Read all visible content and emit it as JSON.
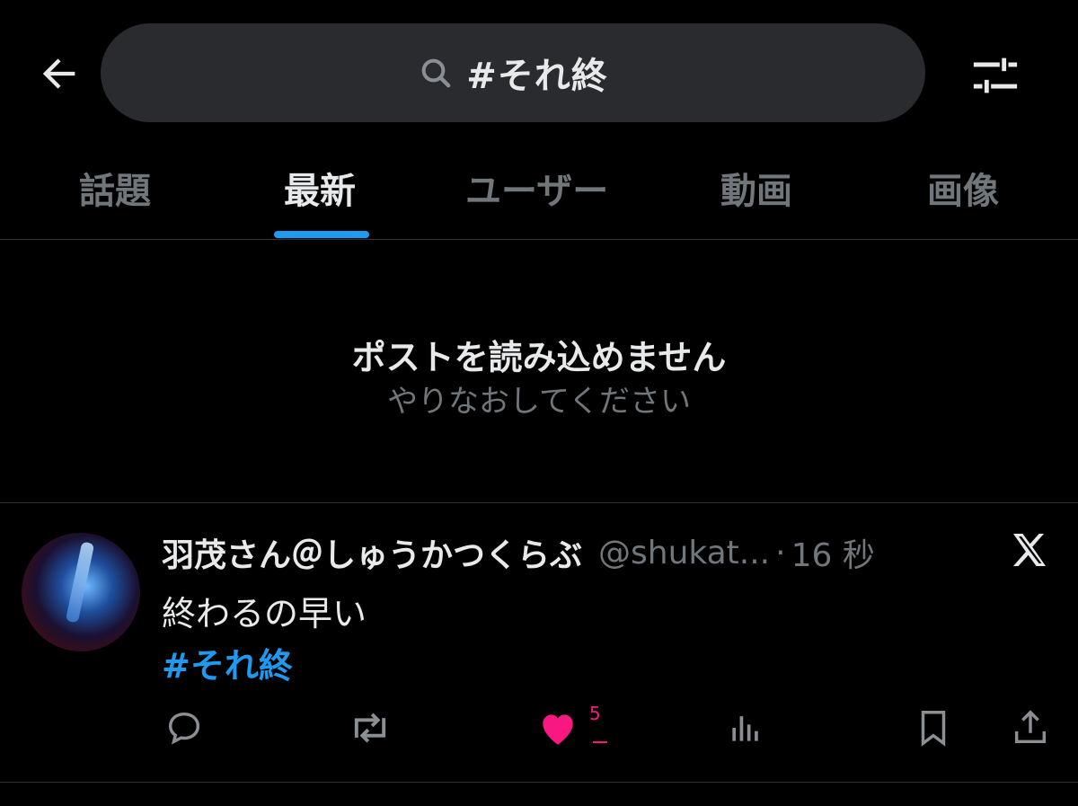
{
  "search": {
    "query": "#それ終"
  },
  "tabs": [
    {
      "label": "話題"
    },
    {
      "label": "最新"
    },
    {
      "label": "ユーザー"
    },
    {
      "label": "動画"
    },
    {
      "label": "画像"
    }
  ],
  "active_tab": "最新",
  "error": {
    "title": "ポストを読み込めません",
    "subtitle": "やりなおしてください"
  },
  "post": {
    "display_name": "羽茂さん＠しゅうかつくらぶ",
    "handle": "@shukat...",
    "separator": "·",
    "time": "16 秒",
    "text": "終わるの早い",
    "hashtag": "#それ終",
    "like_count": "5"
  },
  "colors": {
    "background": "#000000",
    "search_bg": "#2a2b2e",
    "accent": "#1d9bf0",
    "like": "#f91880",
    "muted": "#71767b"
  },
  "icons": {
    "back": "arrow-left-icon",
    "search": "search-icon",
    "filter": "filter-sliders-icon",
    "reply": "reply-icon",
    "repost": "repost-icon",
    "like": "heart-filled-icon",
    "views": "views-bar-icon",
    "bookmark": "bookmark-icon",
    "share": "share-icon",
    "logo": "x-logo-icon"
  }
}
